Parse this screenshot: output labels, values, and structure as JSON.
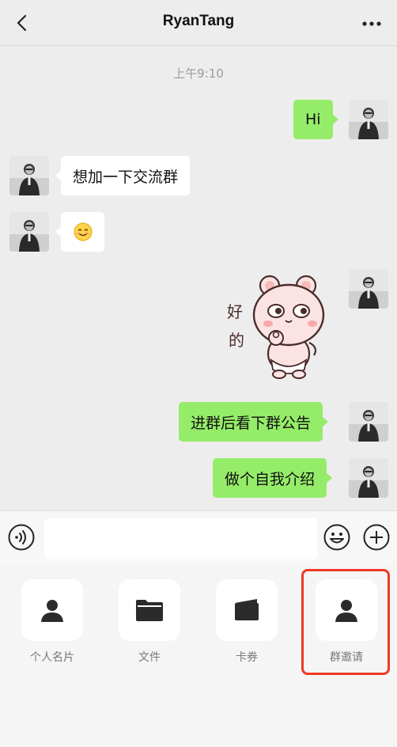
{
  "header": {
    "title": "RyanTang"
  },
  "chat": {
    "timestamp": "上午9:10",
    "messages": [
      {
        "from": "self",
        "text": "Hi"
      },
      {
        "from": "other",
        "text": "想加一下交流群"
      },
      {
        "from": "other",
        "text": "☺"
      },
      {
        "from": "self",
        "type": "sticker",
        "text": "好的"
      },
      {
        "from": "self",
        "text": "进群后看下群公告"
      },
      {
        "from": "self",
        "text": "做个自我介绍"
      }
    ]
  },
  "input": {
    "value": ""
  },
  "panel": {
    "items": [
      {
        "label": "个人名片",
        "icon": "contact-card-icon"
      },
      {
        "label": "文件",
        "icon": "folder-icon"
      },
      {
        "label": "卡券",
        "icon": "wallet-icon"
      },
      {
        "label": "群邀请",
        "icon": "group-invite-icon"
      }
    ],
    "highlight_color": "#ee3a25"
  },
  "colors": {
    "self_bubble": "#95ec69",
    "other_bubble": "#ffffff",
    "background": "#ededed"
  }
}
